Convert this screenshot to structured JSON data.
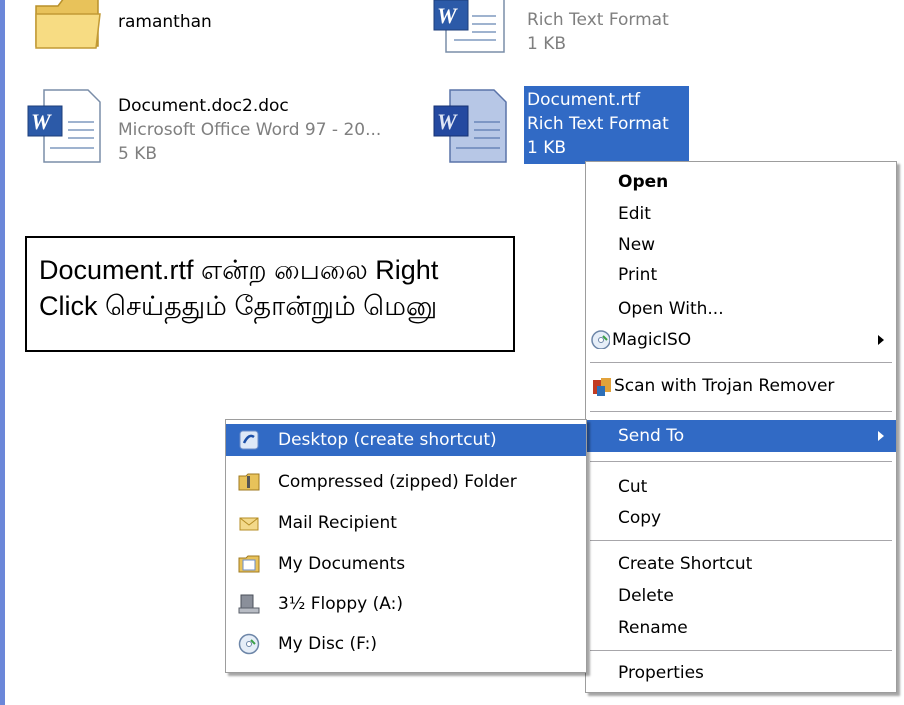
{
  "files": [
    {
      "name": "ramanthan",
      "type": "",
      "size": "",
      "icon": "folder-icon"
    },
    {
      "name": "",
      "type": "Rich Text Format",
      "size": "1 KB",
      "icon": "word-document-icon"
    },
    {
      "name": "Document.doc2.doc",
      "type": "Microsoft Office Word 97 - 20...",
      "size": "5 KB",
      "icon": "word-document-icon"
    },
    {
      "name": "Document.rtf",
      "type": "Rich Text Format",
      "size": "1 KB",
      "icon": "word-document-icon",
      "selected": true
    }
  ],
  "annotation": {
    "line1": "Document.rtf என்ற பைலை Right",
    "line2": "Click செய்ததும் தோன்றும் மெனு"
  },
  "context_menu": {
    "open": "Open",
    "edit": "Edit",
    "new": "New",
    "print": "Print",
    "open_with": "Open With...",
    "magiciso": "MagicISO",
    "scan": "Scan with Trojan Remover",
    "send_to": "Send To",
    "cut": "Cut",
    "copy": "Copy",
    "create_shortcut": "Create Shortcut",
    "delete": "Delete",
    "rename": "Rename",
    "properties": "Properties"
  },
  "send_to_menu": {
    "items": [
      {
        "label": "Desktop (create shortcut)",
        "icon": "desktop-shortcut-icon"
      },
      {
        "label": "Compressed (zipped) Folder",
        "icon": "zip-folder-icon"
      },
      {
        "label": "Mail Recipient",
        "icon": "mail-recipient-icon"
      },
      {
        "label": "My Documents",
        "icon": "my-documents-icon"
      },
      {
        "label": "3½ Floppy (A:)",
        "icon": "floppy-drive-icon"
      },
      {
        "label": "My Disc (F:)",
        "icon": "disc-drive-icon"
      }
    ]
  },
  "colors": {
    "selection": "#316ac5",
    "left_edge": "#6b87d9"
  }
}
